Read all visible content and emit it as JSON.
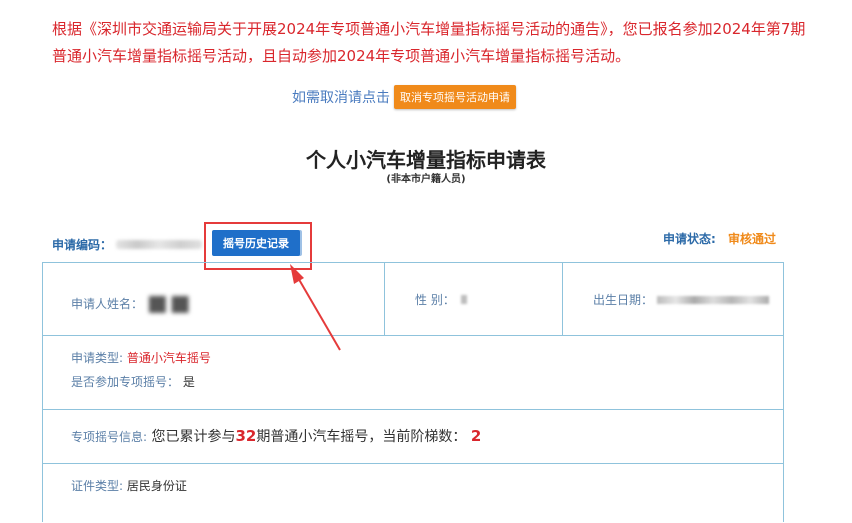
{
  "notice": {
    "text": "根据《深圳市交通运输局关于开展2024年专项普通小汽车增量指标摇号活动的通告》，您已报名参加2024年第7期普通小汽车增量指标摇号活动，且自动参加2024年专项普通小汽车增量指标摇号活动。"
  },
  "cancel": {
    "prompt": "如需取消请点击",
    "button_label": "取消专项摇号活动申请"
  },
  "form": {
    "title": "个人小汽车增量指标申请表",
    "subtitle": "(非本市户籍人员)"
  },
  "application": {
    "code_label": "申请编码：",
    "history_button": "摇号历史记录",
    "status_label": "申请状态:",
    "status_value": "审核通过"
  },
  "applicant": {
    "name_label": "申请人姓名：",
    "gender_label": "性 别：",
    "dob_label": "出生日期："
  },
  "lottery": {
    "type_label": "申请类型:",
    "type_value": "普通小汽车摇号",
    "special_label": "是否参加专项摇号：",
    "special_value": "是"
  },
  "special_info": {
    "label": "专项摇号信息:",
    "text_before": "您已累计参与",
    "count": "32",
    "text_middle": "期普通小汽车摇号，当前阶梯数：",
    "tier": "2"
  },
  "certificate": {
    "label": "证件类型:",
    "value": "居民身份证"
  },
  "colors": {
    "notice_red": "#d9262c",
    "accent_blue": "#1f6fc9",
    "accent_orange": "#f08a1a",
    "border_blue": "#8fc3dc",
    "highlight_red": "#e53b3b"
  }
}
